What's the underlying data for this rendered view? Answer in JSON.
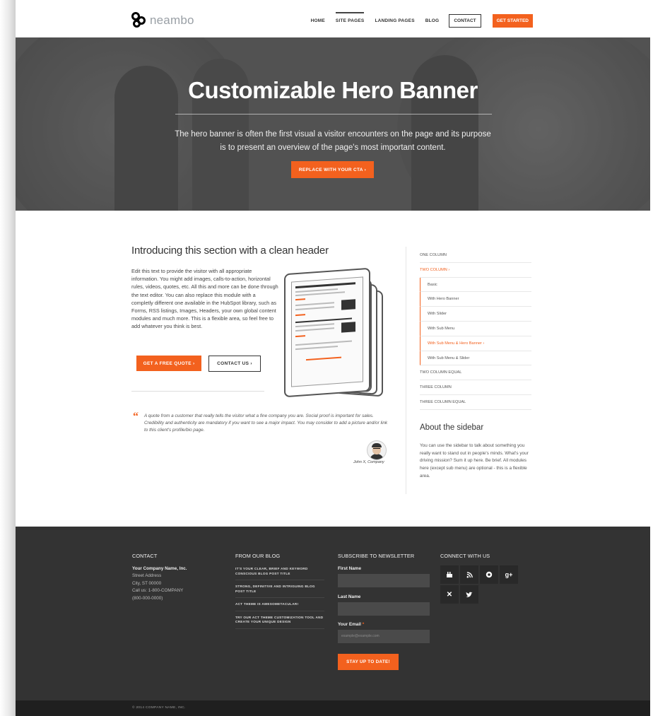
{
  "brand": {
    "logo_text": "neambo"
  },
  "nav": {
    "items": [
      "HOME",
      "SITE PAGES",
      "LANDING PAGES",
      "BLOG"
    ],
    "contact_label": "CONTACT",
    "cta_label": "GET STARTED"
  },
  "hero": {
    "title": "Customizable Hero Banner",
    "subtitle": "The hero banner is often the first visual a visitor encounters on the page and its purpose is to present an overview of the page's most important content.",
    "cta_label": "REPLACE WITH YOUR CTA ›"
  },
  "main": {
    "title": "Introducing this section with a clean header",
    "body": "Edit this text to provide the visitor with all appropriate information. You might add images, calls-to-action, horizontal rules, videos, quotes, etc. All this and more can be done through the text editor. You can also replace this module with a completly different one available in the HubSpot library, such as Forms, RSS listings, Images, Headers, your own global content modules and much more. This is a flexible area, so feel free to add whatever you think is best.",
    "quote_button": "GET A FREE QUOTE ›",
    "contact_button": "CONTACT US ›",
    "quote_text": "A quote from a customer that really tells the visitor what a fine company you are. Social proof is important for sales. Credibility and authenticity are mandatory if you want to see a major impact. You may consider to add a picture and/or link to this client's profile/bio page.",
    "quote_author": "John X, Company"
  },
  "sidebar": {
    "items": [
      {
        "label": "ONE COLUMN"
      },
      {
        "label": "TWO COLUMN ›"
      },
      {
        "label": "Basic"
      },
      {
        "label": "With Hero Banner"
      },
      {
        "label": "With Slider"
      },
      {
        "label": "With Sub Menu"
      },
      {
        "label": "With Sub Menu & Hero Banner ›"
      },
      {
        "label": "With Sub Menu & Slider"
      },
      {
        "label": "TWO COLUMN EQUAL"
      },
      {
        "label": "THREE COLUMN"
      },
      {
        "label": "THREE COLUMN EQUAL"
      }
    ],
    "about_title": "About the sidebar",
    "about_text": "You can use the sidebar to talk about something you really want to stand out in people's minds. What's your driving mission? Sum it up here. Be brief. All modules here (except sub menu) are optional - this is a flexible area."
  },
  "footer": {
    "contact": {
      "heading": "CONTACT",
      "company": "Your Company Name, Inc.",
      "street": "Street Address",
      "city": "City, ST 00000",
      "call": "Call us: 1-800-COMPANY",
      "phone": "(800-000-0000)"
    },
    "blog": {
      "heading": "FROM OUR BLOG",
      "posts": [
        "IT'S YOUR CLEAR, BRIEF AND KEYWORD CONSCIOUS BLOG POST TITLE",
        "STRONG, DEFINITIVE AND INTRIGUING BLOG POST TITLE",
        "ACT THEME IS AWESOMETACULAR!",
        "TRY OUR ACT THEME CUSTOMIZATION TOOL AND CREATE YOUR UNIQUE DESIGN"
      ]
    },
    "newsletter": {
      "heading": "SUBSCRIBE TO NEWSLETTER",
      "first_name_label": "First Name",
      "last_name_label": "Last Name",
      "email_label": "Your Email",
      "required_mark": "*",
      "email_placeholder": "example@example.com",
      "submit_label": "STAY UP TO DATE!"
    },
    "connect": {
      "heading": "CONNECT WITH US",
      "icons": [
        "youtube-icon",
        "rss-icon",
        "pinterest-icon",
        "google-plus-icon",
        "xing-icon",
        "twitter-icon"
      ]
    },
    "copyright": "© 2014 COMPANY NAME, INC."
  },
  "colors": {
    "accent": "#f3611e",
    "footer_bg": "#333333",
    "copyright_bg": "#1f1f1f"
  }
}
